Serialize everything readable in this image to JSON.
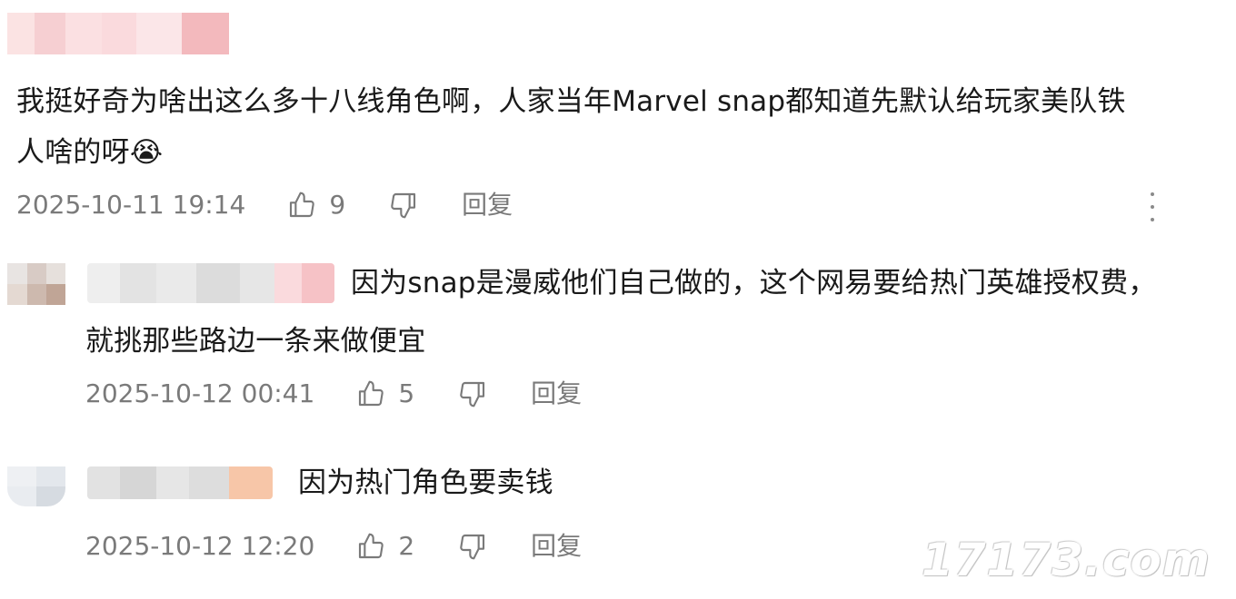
{
  "comments": [
    {
      "text_line1": "我挺好奇为啥出这么多十八线角色啊，人家当年Marvel snap都知道先默认给玩家美队铁",
      "text_line2": "人啥的呀",
      "emoji": "😭",
      "timestamp": "2025-10-11 19:14",
      "likes": "9",
      "reply_label": "回复",
      "more_icon": "more-vertical-icon"
    },
    {
      "text_line1": "因为snap是漫威他们自己做的，这个网易要给热门英雄授权费，",
      "text_line2": "就挑那些路边一条来做便宜",
      "timestamp": "2025-10-12 00:41",
      "likes": "5",
      "reply_label": "回复"
    },
    {
      "text_line1": "因为热门角色要卖钱",
      "timestamp": "2025-10-12 12:20",
      "likes": "2",
      "reply_label": "回复"
    }
  ],
  "watermark": "17173.com",
  "colors": {
    "text": "#1a1a1a",
    "meta": "#7a7a7a",
    "blur_pink": "#f7c9c9",
    "blur_gray": "#d9d9d9"
  }
}
